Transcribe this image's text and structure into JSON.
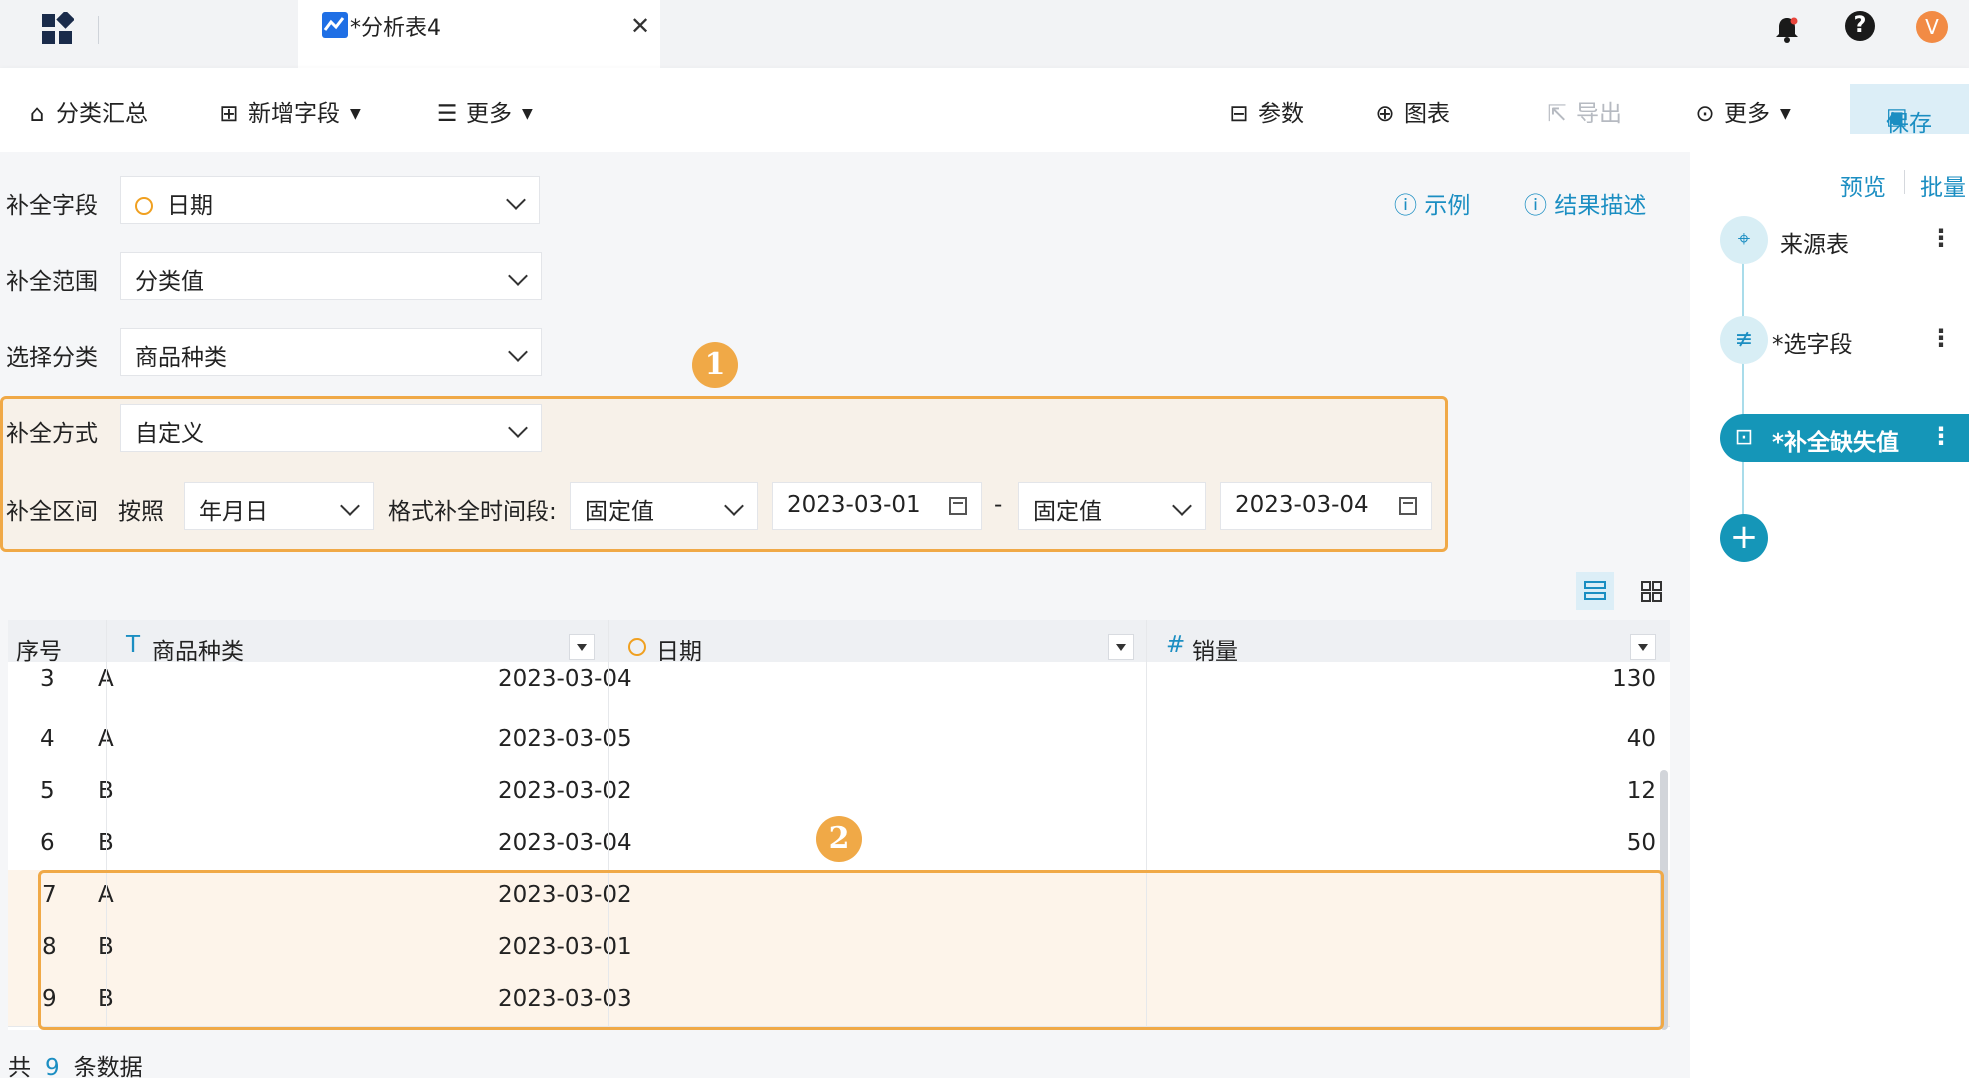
{
  "tabs": {
    "active_title": "*分析表4",
    "close_glyph": "✕"
  },
  "header": {
    "avatar_letter": "V",
    "help_glyph": "?"
  },
  "toolbar": {
    "group_summary": "分类汇总",
    "add_field": "新增字段",
    "more_left": "更多",
    "params": "参数",
    "chart": "图表",
    "export": "导出",
    "more_right": "更多",
    "save": "保存"
  },
  "form": {
    "fill_field_label": "补全字段",
    "fill_field_value": "日期",
    "fill_range_label": "补全范围",
    "fill_range_value": "分类值",
    "select_category_label": "选择分类",
    "select_category_value": "商品种类",
    "fill_method_label": "补全方式",
    "fill_method_value": "自定义",
    "fill_interval_label": "补全区间",
    "by_label": "按照",
    "granularity_value": "年月日",
    "format_label": "格式补全时间段:",
    "start_type": "固定值",
    "start_date": "2023-03-01",
    "range_dash": "-",
    "end_type": "固定值",
    "end_date": "2023-03-04",
    "example_link": "示例",
    "result_desc_link": "结果描述"
  },
  "callouts": {
    "one": "1",
    "two": "2"
  },
  "table": {
    "columns": [
      {
        "label": "序号",
        "type_icon": ""
      },
      {
        "label": "商品种类",
        "type_icon": "T"
      },
      {
        "label": "日期",
        "type_icon": "clock"
      },
      {
        "label": "销量",
        "type_icon": "#"
      }
    ],
    "rows": [
      {
        "idx": "3",
        "category": "A",
        "date": "2023-03-04",
        "sales": "130",
        "filled": false
      },
      {
        "idx": "4",
        "category": "A",
        "date": "2023-03-05",
        "sales": "40",
        "filled": false
      },
      {
        "idx": "5",
        "category": "B",
        "date": "2023-03-02",
        "sales": "12",
        "filled": false
      },
      {
        "idx": "6",
        "category": "B",
        "date": "2023-03-04",
        "sales": "50",
        "filled": false
      },
      {
        "idx": "7",
        "category": "A",
        "date": "2023-03-02",
        "sales": "",
        "filled": true
      },
      {
        "idx": "8",
        "category": "B",
        "date": "2023-03-01",
        "sales": "",
        "filled": true
      },
      {
        "idx": "9",
        "category": "B",
        "date": "2023-03-03",
        "sales": "",
        "filled": true
      }
    ]
  },
  "footer": {
    "prefix": "共",
    "count": "9",
    "suffix": "条数据"
  },
  "right_panel": {
    "preview": "预览",
    "batch": "批量",
    "steps": [
      {
        "name": "来源表",
        "icon": "target-icon"
      },
      {
        "name": "*选字段",
        "icon": "select-fields-icon"
      },
      {
        "name": "*补全缺失值",
        "icon": "fill-missing-icon"
      }
    ]
  },
  "colors": {
    "accent": "#1b8ec2",
    "highlight": "#f0a947",
    "active_node": "#1596b8"
  }
}
